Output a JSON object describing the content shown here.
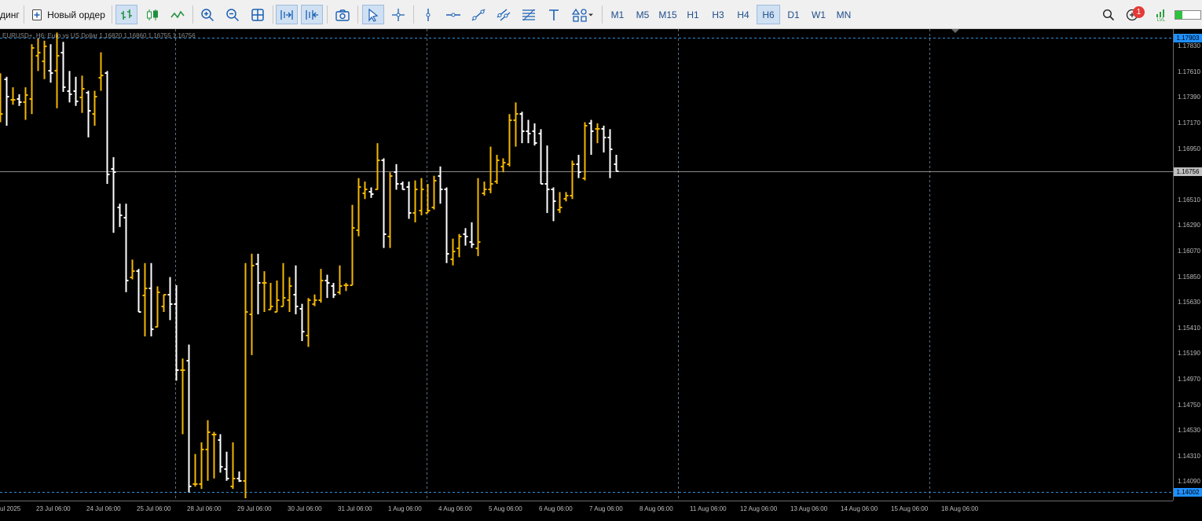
{
  "toolbar": {
    "trading_label": "динг",
    "new_order_label": "Новый ордер",
    "timeframes": [
      "M1",
      "M5",
      "M15",
      "H1",
      "H3",
      "H4",
      "H6",
      "D1",
      "W1",
      "MN"
    ],
    "selected_timeframe": "H6",
    "notification_count": "1",
    "level_label": "LVL"
  },
  "chart_header": {
    "symbol_info": "EURUSD+, H6: Euro vs US Dollar  1.16820  1.16860  1.16755  1.16756"
  },
  "colors": {
    "background": "#000000",
    "bull_bar": "#f5b700",
    "bear_bar": "#ffffff",
    "grid_dash": "#5b6f80",
    "bid_line": "#8a8a8a",
    "level_line": "#2f8fd8",
    "price_box_high": "#1e90ff",
    "price_box_bid": "#c0c0c0"
  },
  "chart_data": {
    "type": "ohlc",
    "price_axis": [
      "1.17830",
      "1.17610",
      "1.17390",
      "1.17170",
      "1.16950",
      "1.16730",
      "1.16510",
      "1.16290",
      "1.16070",
      "1.15850",
      "1.15630",
      "1.15410",
      "1.15190",
      "1.14970",
      "1.14750",
      "1.14530",
      "1.14310",
      "1.14090"
    ],
    "price_high_label": "1.17903",
    "price_bid_label": "1.16756",
    "price_low_label": "1.14002",
    "level_high": 1.17903,
    "level_low": 1.14002,
    "bid": 1.16756,
    "ylim": [
      1.1393,
      1.1798
    ],
    "time_axis": [
      "ul 2025",
      "23 Jul 06:00",
      "24 Jul 06:00",
      "25 Jul 06:00",
      "28 Jul 06:00",
      "29 Jul 06:00",
      "30 Jul 06:00",
      "31 Jul 06:00",
      "1 Aug 06:00",
      "4 Aug 06:00",
      "5 Aug 06:00",
      "6 Aug 06:00",
      "7 Aug 06:00",
      "8 Aug 06:00",
      "11 Aug 06:00",
      "12 Aug 06:00",
      "13 Aug 06:00",
      "14 Aug 06:00",
      "15 Aug 06:00",
      "18 Aug 06:00"
    ],
    "bars": [
      {
        "o": 1.1725,
        "h": 1.176,
        "l": 1.1718,
        "c": 1.1725
      },
      {
        "o": 1.1755,
        "h": 1.1757,
        "l": 1.1715,
        "c": 1.174
      },
      {
        "o": 1.1737,
        "h": 1.1748,
        "l": 1.1733,
        "c": 1.1737
      },
      {
        "o": 1.1738,
        "h": 1.1742,
        "l": 1.1732,
        "c": 1.1735
      },
      {
        "o": 1.1735,
        "h": 1.1748,
        "l": 1.172,
        "c": 1.1741
      },
      {
        "o": 1.1738,
        "h": 1.1785,
        "l": 1.1725,
        "c": 1.1782
      },
      {
        "o": 1.1775,
        "h": 1.179,
        "l": 1.1762,
        "c": 1.1778
      },
      {
        "o": 1.177,
        "h": 1.1788,
        "l": 1.1755,
        "c": 1.1783
      },
      {
        "o": 1.1762,
        "h": 1.1785,
        "l": 1.1752,
        "c": 1.176
      },
      {
        "o": 1.1762,
        "h": 1.1795,
        "l": 1.173,
        "c": 1.1775
      },
      {
        "o": 1.1778,
        "h": 1.1787,
        "l": 1.1744,
        "c": 1.1748
      },
      {
        "o": 1.1745,
        "h": 1.1762,
        "l": 1.1735,
        "c": 1.1742
      },
      {
        "o": 1.1745,
        "h": 1.1757,
        "l": 1.1732,
        "c": 1.1736
      },
      {
        "o": 1.1739,
        "h": 1.1758,
        "l": 1.1726,
        "c": 1.1747
      },
      {
        "o": 1.1743,
        "h": 1.1745,
        "l": 1.1705,
        "c": 1.1728
      },
      {
        "o": 1.1725,
        "h": 1.1745,
        "l": 1.1715,
        "c": 1.174
      },
      {
        "o": 1.1756,
        "h": 1.1778,
        "l": 1.1745,
        "c": 1.1758
      },
      {
        "o": 1.176,
        "h": 1.1762,
        "l": 1.1665,
        "c": 1.1673
      },
      {
        "o": 1.1678,
        "h": 1.1688,
        "l": 1.1623,
        "c": 1.1675
      },
      {
        "o": 1.1645,
        "h": 1.1648,
        "l": 1.1628,
        "c": 1.1638
      },
      {
        "o": 1.1636,
        "h": 1.1648,
        "l": 1.1572,
        "c": 1.1582
      },
      {
        "o": 1.1585,
        "h": 1.16,
        "l": 1.1583,
        "c": 1.159
      },
      {
        "o": 1.159,
        "h": 1.1592,
        "l": 1.1555,
        "c": 1.1555
      },
      {
        "o": 1.1569,
        "h": 1.1597,
        "l": 1.1534,
        "c": 1.1575
      },
      {
        "o": 1.1575,
        "h": 1.1597,
        "l": 1.1534,
        "c": 1.154
      },
      {
        "o": 1.1542,
        "h": 1.1577,
        "l": 1.1542,
        "c": 1.1572
      },
      {
        "o": 1.156,
        "h": 1.157,
        "l": 1.1555,
        "c": 1.157
      },
      {
        "o": 1.157,
        "h": 1.1585,
        "l": 1.1548,
        "c": 1.1562
      },
      {
        "o": 1.1562,
        "h": 1.1578,
        "l": 1.1496,
        "c": 1.1505
      },
      {
        "o": 1.1505,
        "h": 1.1515,
        "l": 1.145,
        "c": 1.1505
      },
      {
        "o": 1.1513,
        "h": 1.1527,
        "l": 1.14,
        "c": 1.1405
      },
      {
        "o": 1.1407,
        "h": 1.1433,
        "l": 1.1405,
        "c": 1.1407
      },
      {
        "o": 1.1407,
        "h": 1.1443,
        "l": 1.1403,
        "c": 1.1437
      },
      {
        "o": 1.1437,
        "h": 1.1462,
        "l": 1.141,
        "c": 1.1452
      },
      {
        "o": 1.145,
        "h": 1.1452,
        "l": 1.1412,
        "c": 1.145
      },
      {
        "o": 1.1445,
        "h": 1.145,
        "l": 1.1417,
        "c": 1.1422
      },
      {
        "o": 1.142,
        "h": 1.1435,
        "l": 1.141,
        "c": 1.1412
      },
      {
        "o": 1.1405,
        "h": 1.1443,
        "l": 1.1403,
        "c": 1.1412
      },
      {
        "o": 1.1412,
        "h": 1.1418,
        "l": 1.1409,
        "c": 1.141
      },
      {
        "o": 1.141,
        "h": 1.1597,
        "l": 1.1395,
        "c": 1.1555
      },
      {
        "o": 1.1553,
        "h": 1.1605,
        "l": 1.1518,
        "c": 1.1595
      },
      {
        "o": 1.1596,
        "h": 1.1605,
        "l": 1.1553,
        "c": 1.158
      },
      {
        "o": 1.158,
        "h": 1.159,
        "l": 1.1555,
        "c": 1.158
      },
      {
        "o": 1.1557,
        "h": 1.158,
        "l": 1.1557,
        "c": 1.156
      },
      {
        "o": 1.1555,
        "h": 1.1582,
        "l": 1.1555,
        "c": 1.1565
      },
      {
        "o": 1.156,
        "h": 1.1597,
        "l": 1.156,
        "c": 1.1567
      },
      {
        "o": 1.1565,
        "h": 1.1585,
        "l": 1.1555,
        "c": 1.1577
      },
      {
        "o": 1.157,
        "h": 1.1595,
        "l": 1.1553,
        "c": 1.156
      },
      {
        "o": 1.1558,
        "h": 1.1562,
        "l": 1.153,
        "c": 1.1538
      },
      {
        "o": 1.1535,
        "h": 1.1567,
        "l": 1.1525,
        "c": 1.1565
      },
      {
        "o": 1.1562,
        "h": 1.157,
        "l": 1.156,
        "c": 1.1565
      },
      {
        "o": 1.1565,
        "h": 1.1592,
        "l": 1.1563,
        "c": 1.1582
      },
      {
        "o": 1.1582,
        "h": 1.1587,
        "l": 1.1567,
        "c": 1.158
      },
      {
        "o": 1.1577,
        "h": 1.158,
        "l": 1.1567,
        "c": 1.157
      },
      {
        "o": 1.1572,
        "h": 1.1595,
        "l": 1.157,
        "c": 1.1577
      },
      {
        "o": 1.1578,
        "h": 1.158,
        "l": 1.1573,
        "c": 1.1578
      },
      {
        "o": 1.1578,
        "h": 1.1647,
        "l": 1.1578,
        "c": 1.1627
      },
      {
        "o": 1.1625,
        "h": 1.167,
        "l": 1.162,
        "c": 1.1662
      },
      {
        "o": 1.1657,
        "h": 1.1667,
        "l": 1.1652,
        "c": 1.166
      },
      {
        "o": 1.1658,
        "h": 1.1662,
        "l": 1.1653,
        "c": 1.1656
      },
      {
        "o": 1.166,
        "h": 1.17,
        "l": 1.166,
        "c": 1.1685
      },
      {
        "o": 1.1685,
        "h": 1.1687,
        "l": 1.161,
        "c": 1.1622
      },
      {
        "o": 1.162,
        "h": 1.1675,
        "l": 1.161,
        "c": 1.1672
      },
      {
        "o": 1.1675,
        "h": 1.1682,
        "l": 1.166,
        "c": 1.1665
      },
      {
        "o": 1.1665,
        "h": 1.1667,
        "l": 1.166,
        "c": 1.166
      },
      {
        "o": 1.1662,
        "h": 1.1667,
        "l": 1.1635,
        "c": 1.164
      },
      {
        "o": 1.164,
        "h": 1.1668,
        "l": 1.1632,
        "c": 1.166
      },
      {
        "o": 1.1642,
        "h": 1.167,
        "l": 1.1638,
        "c": 1.166
      },
      {
        "o": 1.164,
        "h": 1.1665,
        "l": 1.164,
        "c": 1.1642
      },
      {
        "o": 1.1645,
        "h": 1.1672,
        "l": 1.1643,
        "c": 1.1668
      },
      {
        "o": 1.1672,
        "h": 1.168,
        "l": 1.1648,
        "c": 1.166
      },
      {
        "o": 1.166,
        "h": 1.1662,
        "l": 1.1597,
        "c": 1.1605
      },
      {
        "o": 1.16,
        "h": 1.1618,
        "l": 1.1595,
        "c": 1.1607
      },
      {
        "o": 1.161,
        "h": 1.1622,
        "l": 1.1602,
        "c": 1.162
      },
      {
        "o": 1.1622,
        "h": 1.1627,
        "l": 1.1612,
        "c": 1.162
      },
      {
        "o": 1.1615,
        "h": 1.1632,
        "l": 1.161,
        "c": 1.1613
      },
      {
        "o": 1.161,
        "h": 1.167,
        "l": 1.1603,
        "c": 1.1615
      },
      {
        "o": 1.1657,
        "h": 1.1667,
        "l": 1.1655,
        "c": 1.166
      },
      {
        "o": 1.166,
        "h": 1.1697,
        "l": 1.1657,
        "c": 1.1665
      },
      {
        "o": 1.1667,
        "h": 1.169,
        "l": 1.1665,
        "c": 1.1685
      },
      {
        "o": 1.168,
        "h": 1.1687,
        "l": 1.1675,
        "c": 1.1683
      },
      {
        "o": 1.1682,
        "h": 1.1725,
        "l": 1.168,
        "c": 1.172
      },
      {
        "o": 1.172,
        "h": 1.1735,
        "l": 1.1697,
        "c": 1.1725
      },
      {
        "o": 1.1725,
        "h": 1.1727,
        "l": 1.17,
        "c": 1.171
      },
      {
        "o": 1.171,
        "h": 1.172,
        "l": 1.17,
        "c": 1.1708
      },
      {
        "o": 1.171,
        "h": 1.1717,
        "l": 1.1698,
        "c": 1.17
      },
      {
        "o": 1.1708,
        "h": 1.1712,
        "l": 1.1665,
        "c": 1.1665
      },
      {
        "o": 1.1665,
        "h": 1.1698,
        "l": 1.164,
        "c": 1.166
      },
      {
        "o": 1.166,
        "h": 1.1662,
        "l": 1.1633,
        "c": 1.165
      },
      {
        "o": 1.1643,
        "h": 1.1658,
        "l": 1.164,
        "c": 1.1645
      },
      {
        "o": 1.1652,
        "h": 1.1658,
        "l": 1.165,
        "c": 1.1655
      },
      {
        "o": 1.1655,
        "h": 1.1685,
        "l": 1.1652,
        "c": 1.1682
      },
      {
        "o": 1.1682,
        "h": 1.169,
        "l": 1.167,
        "c": 1.1675
      },
      {
        "o": 1.167,
        "h": 1.1718,
        "l": 1.1668,
        "c": 1.1715
      },
      {
        "o": 1.1717,
        "h": 1.172,
        "l": 1.169,
        "c": 1.171
      },
      {
        "o": 1.1712,
        "h": 1.1717,
        "l": 1.17,
        "c": 1.1712
      },
      {
        "o": 1.1712,
        "h": 1.1715,
        "l": 1.1692,
        "c": 1.1705
      },
      {
        "o": 1.1705,
        "h": 1.1712,
        "l": 1.167,
        "c": 1.1695
      },
      {
        "o": 1.1682,
        "h": 1.169,
        "l": 1.1676,
        "c": 1.1676
      }
    ]
  }
}
